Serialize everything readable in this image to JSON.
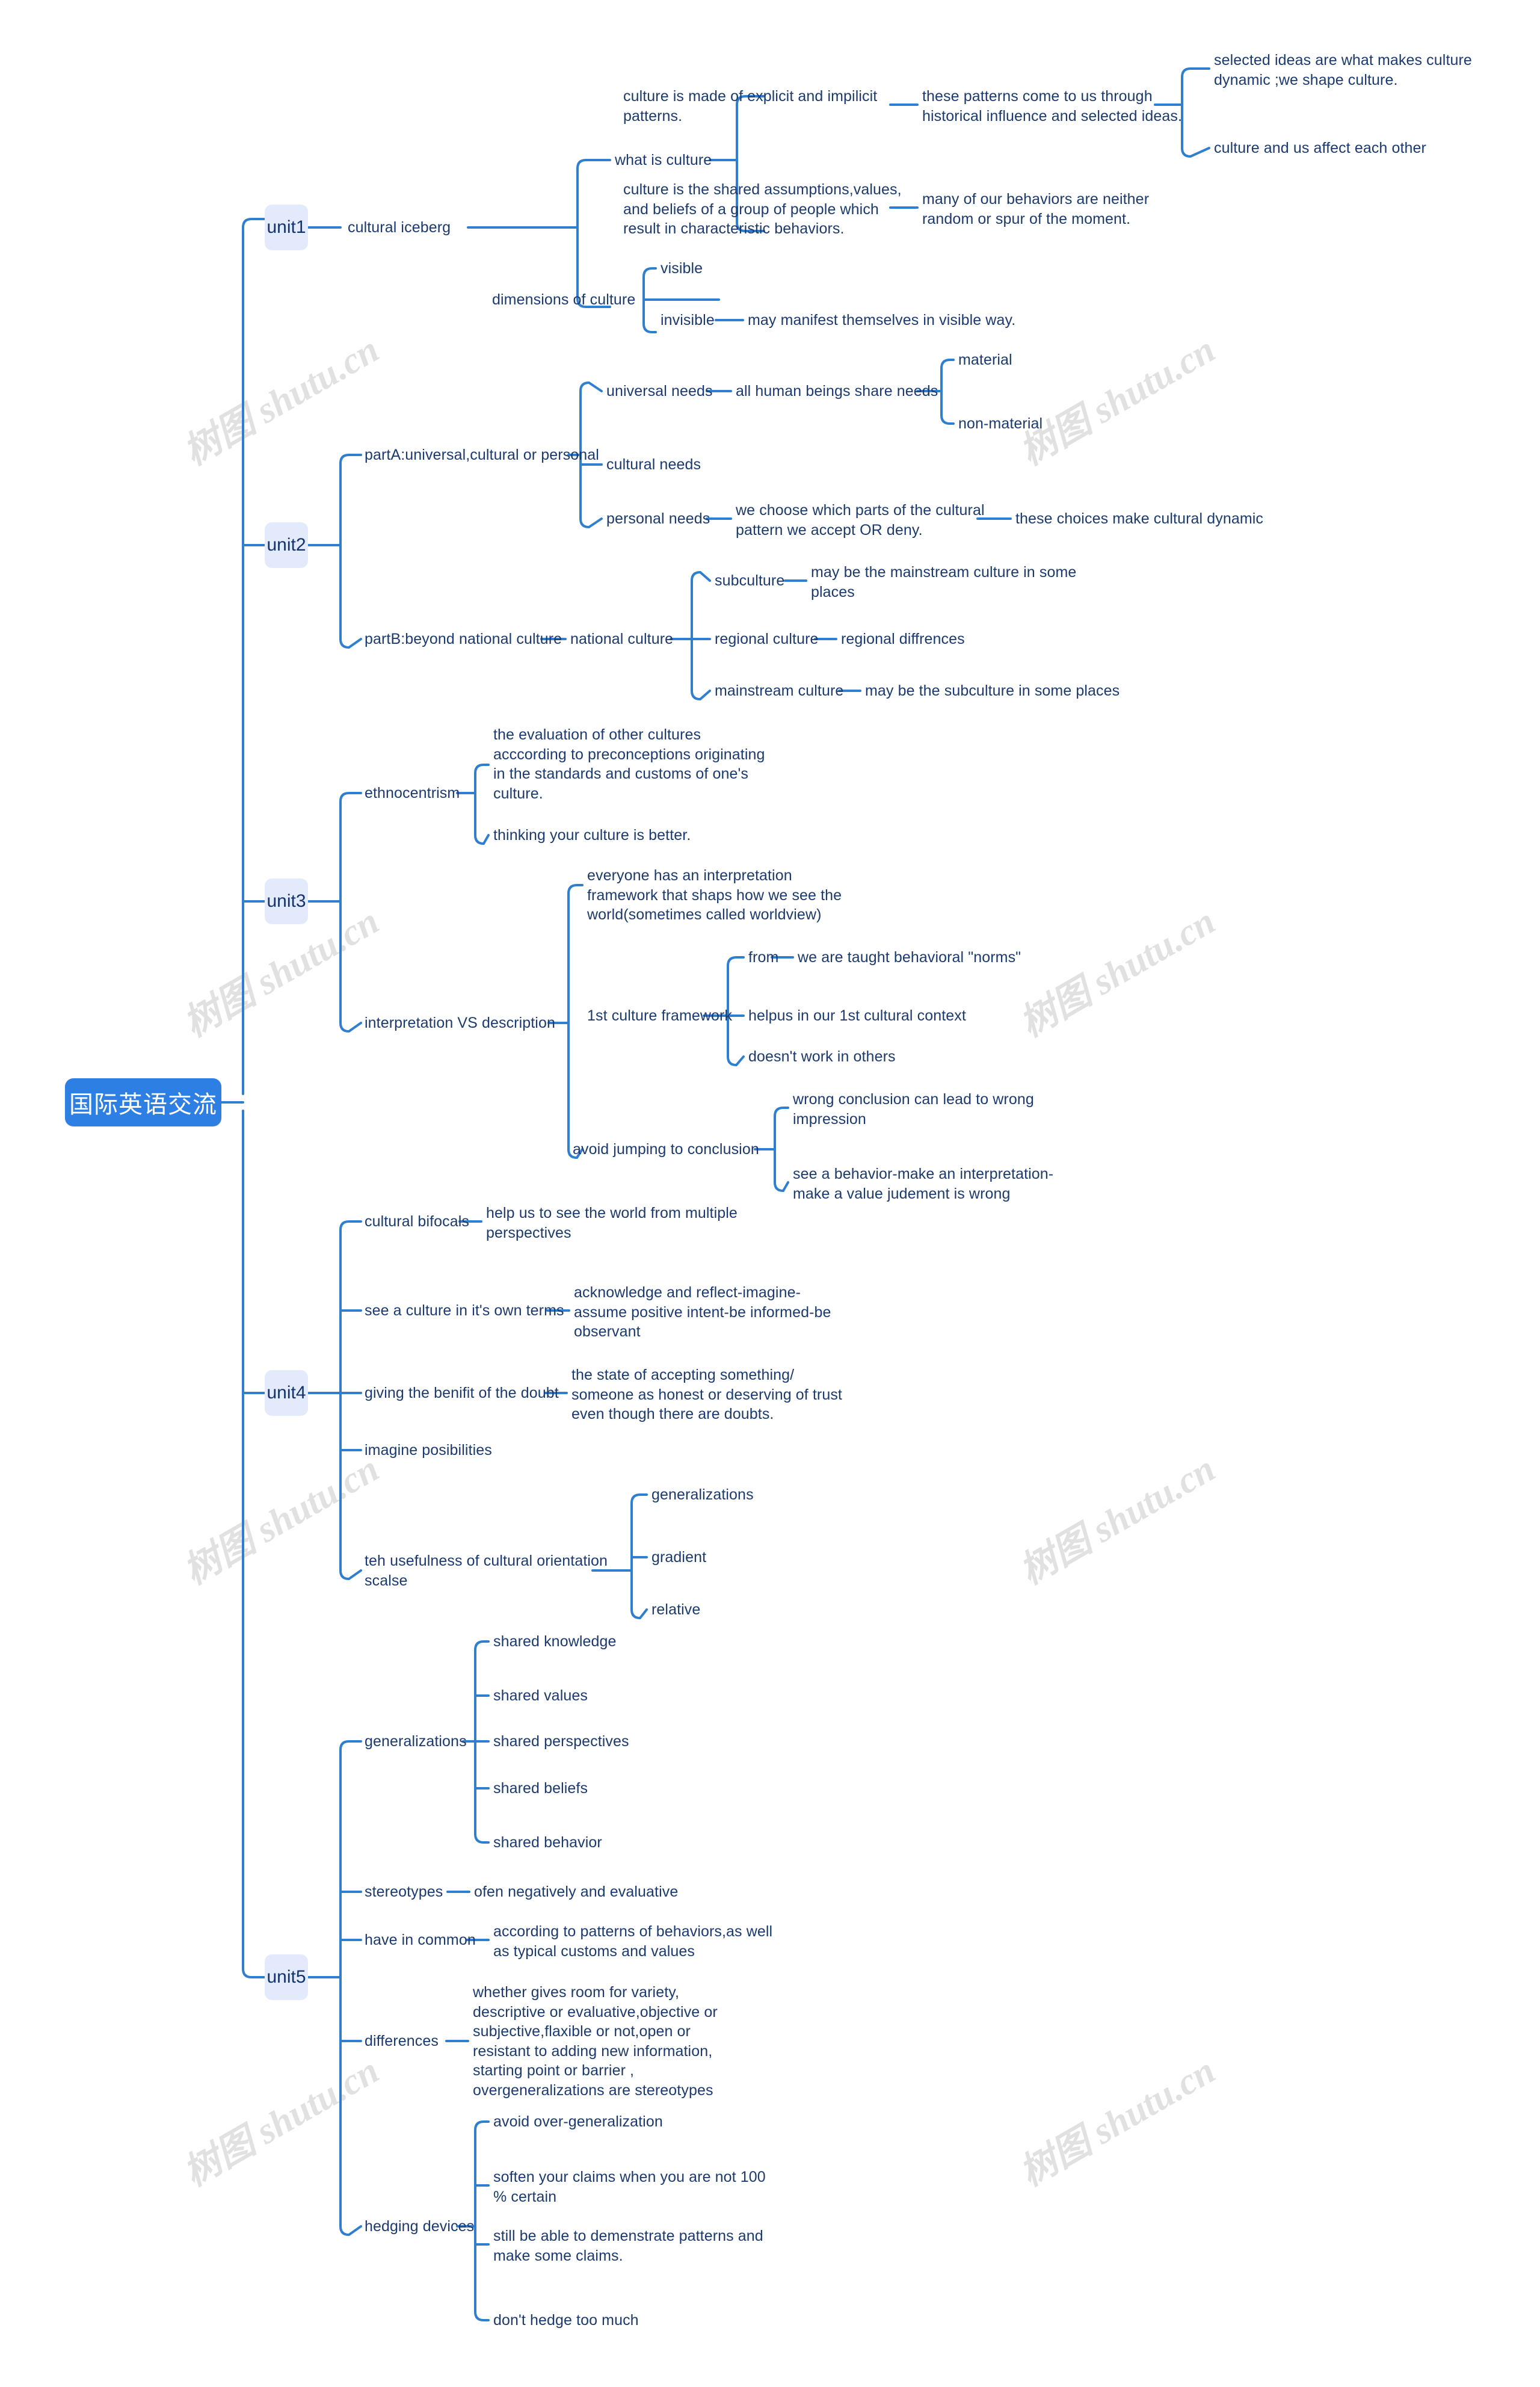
{
  "meta": {
    "diagram_type": "mind-map",
    "colors": {
      "root_fill": "#2e7fe4",
      "root_text": "#ffffff",
      "unit_fill": "#e3eafb",
      "unit_text": "#13336e",
      "edge": "#2f7fd0",
      "node_text": "#1c3a72",
      "background": "#ffffff",
      "watermark": "#c9c9c9"
    }
  },
  "root": {
    "label": "国际英语交流"
  },
  "watermark": {
    "text": "树图 shutu.cn"
  },
  "units": [
    {
      "id": "unit1",
      "label": "unit1"
    },
    {
      "id": "unit2",
      "label": "unit2"
    },
    {
      "id": "unit3",
      "label": "unit3"
    },
    {
      "id": "unit4",
      "label": "unit4"
    },
    {
      "id": "unit5",
      "label": "unit5"
    }
  ],
  "nodes": {
    "cultural_iceberg": "cultural iceberg",
    "what_is_culture": "what is culture",
    "culture_explicit": "culture is made of explicit and impilicit\npatterns.",
    "patterns_historical": "these patterns come to us through\nhistorical influence and selected ideas.",
    "selected_ideas": "selected ideas are what makes culture\ndynamic  ;we shape culture.",
    "culture_affect": "culture and us affect each other",
    "culture_shared": "culture is the shared assumptions,values,\nand beliefs of a group of people which\nresult in characteristic behaviors.",
    "behaviors_neither": "many of our behaviors are neither\nrandom or spur of the moment.",
    "dimensions_of_culture": "dimensions of culture",
    "visible": "visible",
    "invisible": "invisible",
    "manifest_visible": "may manifest themselves in visible way.",
    "partA": "partA:universal,cultural or personal",
    "universal_needs": "universal needs",
    "all_human_beings": "all human beings share needs",
    "material": "material",
    "non_material": "non-material",
    "cultural_needs": "cultural needs",
    "personal_needs": "personal needs",
    "we_choose": "we choose which parts of the cultural\npattern we accept OR deny.",
    "choices_dynamic": "these choices make cultural dynamic",
    "partB": "partB:beyond national culture",
    "national_culture": "national culture",
    "subculture": "subculture",
    "sub_mainstream": "may be the mainstream culture in some\nplaces",
    "regional_culture": "regional culture",
    "regional_diffrences": "regional diffrences",
    "mainstream_culture": "mainstream culture",
    "main_subculture": "may be the subculture in some places",
    "ethnocentrism": "ethnocentrism",
    "evaluation_other": "the evaluation of other cultures\nacccording to preconceptions originating\n in the standards and customs of one's\nculture.",
    "thinking_better": "thinking your culture is better.",
    "interpretation_vs": "interpretation VS description",
    "everyone_framework": "everyone has an interpretation\nframework that shaps how we see the\nworld(sometimes called worldview)",
    "first_culture_framework": "1st culture framework",
    "from": "from",
    "behavioral_norms": "we are taught behavioral \"norms\"",
    "helpus": "helpus in our 1st cultural context",
    "doesnt_work": "doesn't work in others",
    "avoid_jumping": "avoid jumping to conclusion",
    "wrong_conclusion": "wrong conclusion can lead to wrong\nimpression",
    "see_behavior": "see a behavior-make an interpretation-\nmake a value judement is wrong",
    "cultural_bifocals": "cultural bifocals",
    "help_us_see": "help us to see the world from multiple\nperspectives",
    "see_culture_own": "see a culture in it's own terms",
    "acknowledge_reflect": "acknowledge and reflect-imagine-\nassume positive intent-be informed-be\nobservant",
    "giving_benifit": "giving the benifit of the doubt",
    "state_accepting": "the state of accepting something/\nsomeone as honest or deserving of trust\neven though there are doubts.",
    "imagine_posibilities": "imagine posibilities",
    "teh_usefulness": "teh usefulness of cultural orientation\nscalse",
    "generalizations_u4": "generalizations",
    "gradient": "gradient",
    "relative": "relative",
    "generalizations_u5": "generalizations",
    "shared_knowledge": "shared knowledge",
    "shared_values": "shared values",
    "shared_perspectives": "shared perspectives",
    "shared_beliefs": "shared beliefs",
    "shared_behavior": "shared behavior",
    "stereotypes": "stereotypes",
    "ofen_negatively": "ofen negatively and evaluative",
    "have_in_common": "have in common",
    "according_patterns": "according to patterns of behaviors,as well\n as typical customs and values",
    "differences": "differences",
    "whether_gives_room": "whether gives room for variety,\ndescriptive or evaluative,objective or\nsubjective,flaxible or not,open or\nresistant  to adding new information,\nstarting point or barrier ,\novergeneralizations are stereotypes",
    "hedging_devices": "hedging devices",
    "avoid_over_generalization": "avoid over-generalization",
    "soften_claims": "soften your claims when you are not 100\n% certain",
    "still_be_able": "still be able to demenstrate patterns and\nmake some claims.",
    "dont_hedge": "don't hedge too much"
  }
}
